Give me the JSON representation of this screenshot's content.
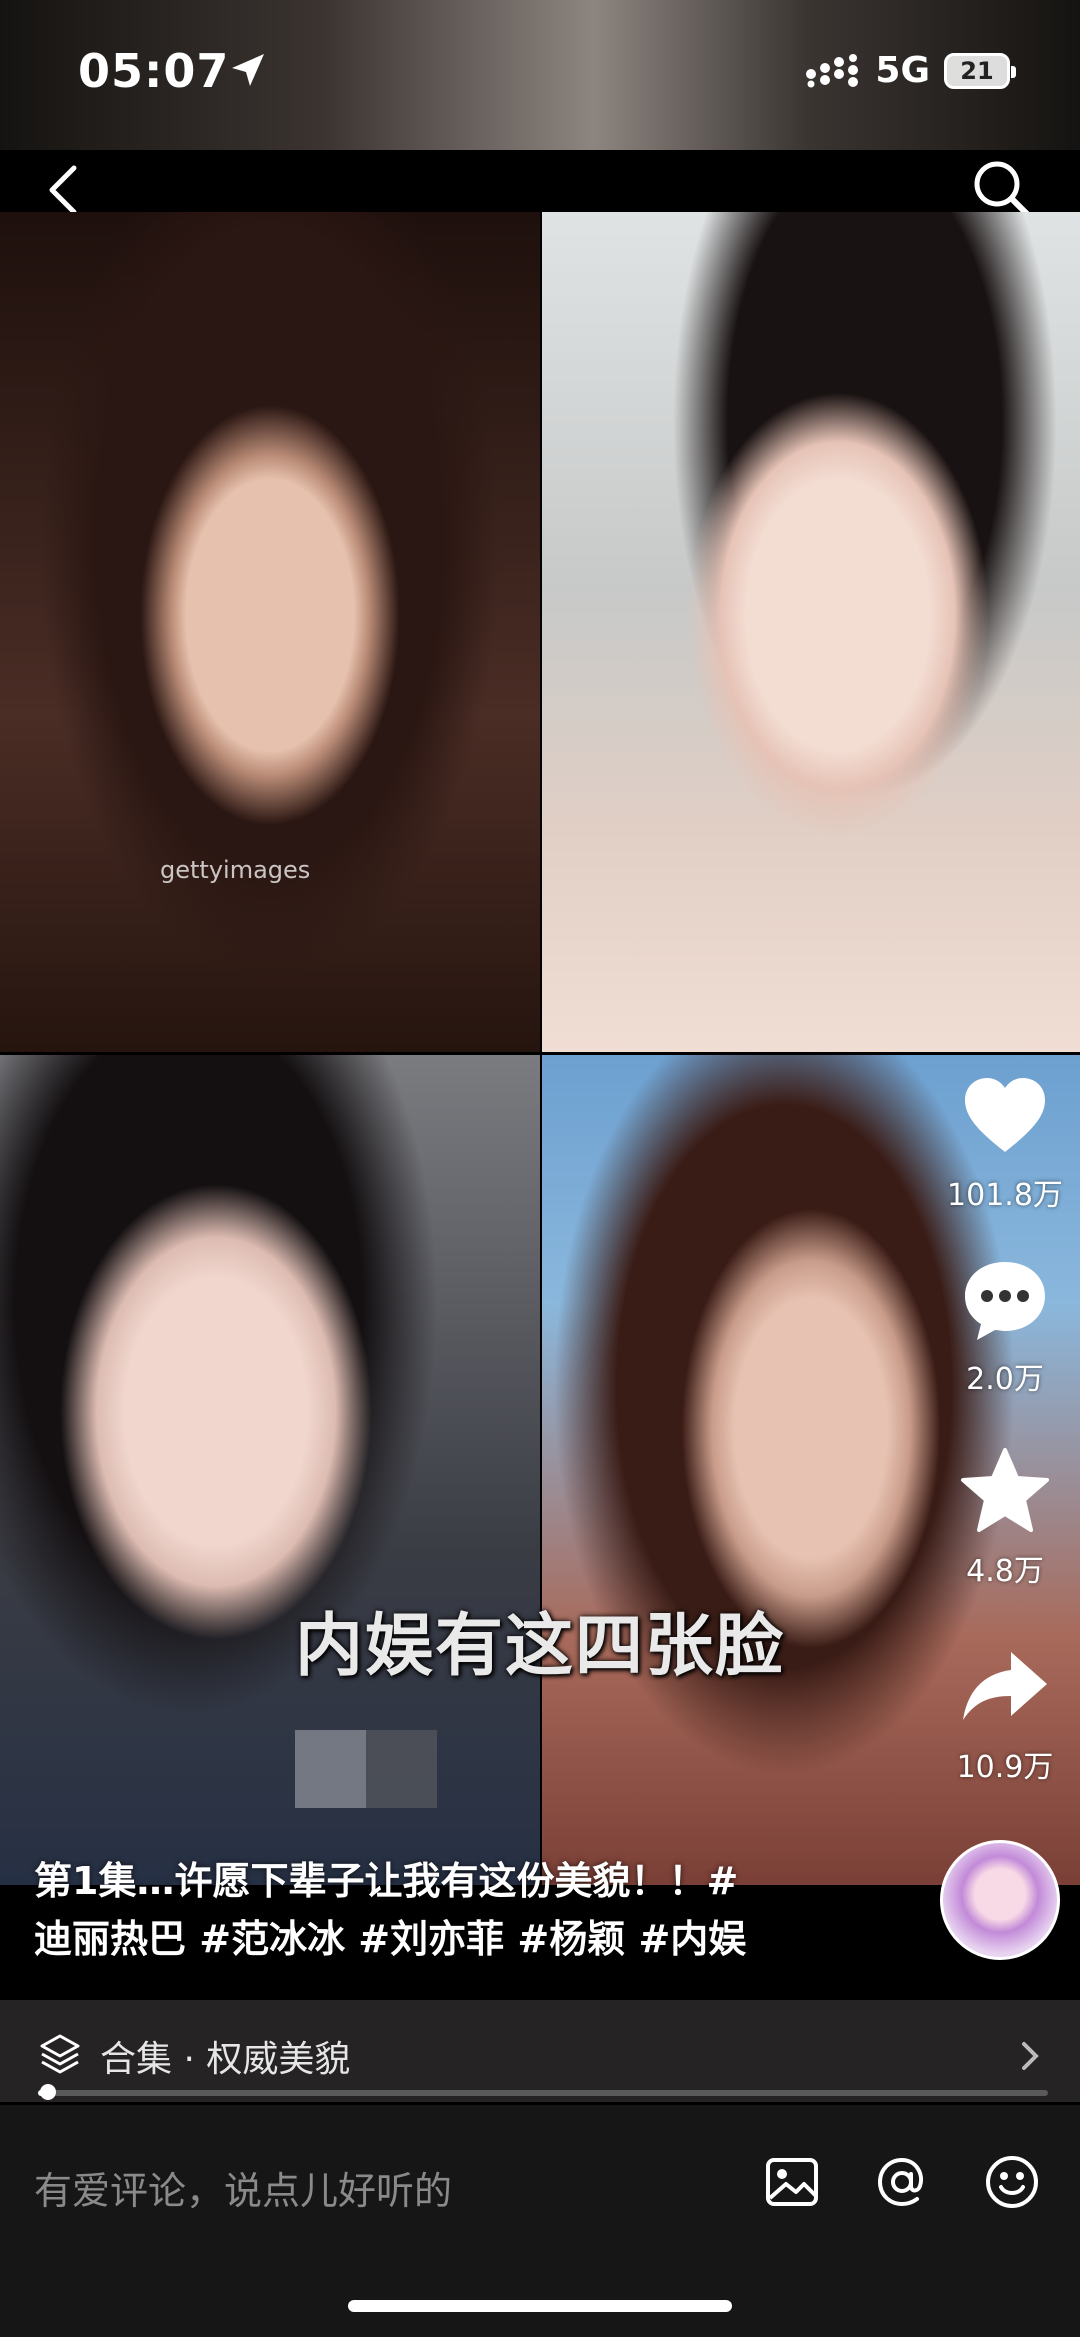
{
  "status_bar": {
    "time": "05:07",
    "network": "5G",
    "battery": "21"
  },
  "media": {
    "watermark": "gettyimages",
    "overlay_caption": "内娱有这四张脸"
  },
  "actions": {
    "likes": "101.8万",
    "comments": "2.0万",
    "favorites": "4.8万",
    "shares": "10.9万"
  },
  "post": {
    "description_line1": "第1集…许愿下辈子让我有这份美貌！！#",
    "description_line2": "迪丽热巴 #范冰冰 #刘亦菲 #杨颖 #内娱"
  },
  "collection": {
    "label": "合集 · 权威美貌"
  },
  "playback": {
    "progress": 0.01
  },
  "comment": {
    "placeholder": "有爱评论，说点儿好听的"
  },
  "icons": {
    "back": "back-arrow-icon",
    "search": "search-icon",
    "like": "heart-icon",
    "comment": "comment-bubble-icon",
    "favorite": "star-icon",
    "share": "share-arrow-icon",
    "collection": "layers-icon",
    "image": "image-icon",
    "mention": "at-icon",
    "emoji": "emoji-icon"
  }
}
